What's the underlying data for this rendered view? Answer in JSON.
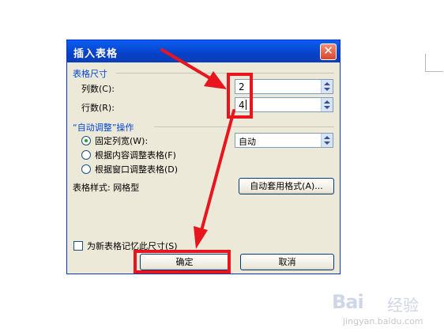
{
  "dialog": {
    "title": "插入表格",
    "close_label": "✕",
    "table_size_section": "表格尺寸",
    "columns_label": "列数(C):",
    "columns_value": "2",
    "rows_label": "行数(R):",
    "rows_value": "4",
    "autofit_section": "“自动调整”操作",
    "fixed_width_label": "固定列宽(W):",
    "fixed_width_value": "自动",
    "autofit_content_label": "根据内容调整表格(F)",
    "autofit_window_label": "根据窗口调整表格(D)",
    "table_style_label": "表格样式: 网格型",
    "autoformat_button": "自动套用格式(A)...",
    "remember_label": "为新表格记忆此尺寸(S)",
    "ok_button": "确定",
    "cancel_button": "取消"
  },
  "annotation": {
    "highlight_color": "#e8141e"
  },
  "watermark": {
    "logo": "Bai",
    "sub": "经验",
    "url": "jingyan.baidu.com"
  }
}
